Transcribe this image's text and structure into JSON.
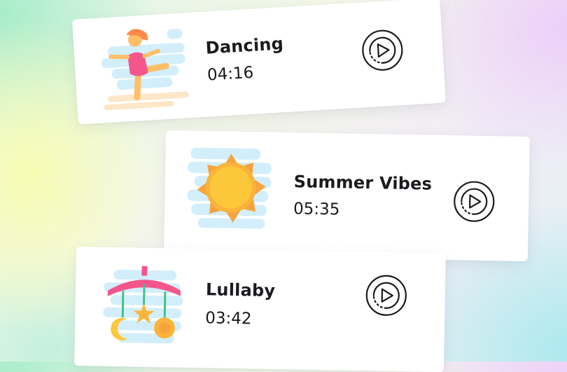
{
  "tracks": [
    {
      "title": "Dancing",
      "duration": "04:16",
      "thumbnail_icon": "dancing-girl-icon",
      "action_icon": "play-icon"
    },
    {
      "title": "Summer Vibes",
      "duration": "05:35",
      "thumbnail_icon": "sun-icon",
      "action_icon": "play-icon"
    },
    {
      "title": "Lullaby",
      "duration": "03:42",
      "thumbnail_icon": "baby-mobile-icon",
      "action_icon": "play-icon"
    }
  ],
  "colors": {
    "card_background": "#ffffff",
    "text": "#1b1b1f",
    "sun_outer": "#f5a43d",
    "sun_inner": "#fcc73a",
    "thumbnail_backdrop": "#d2eefb",
    "accent_pink": "#f4568c",
    "accent_orange": "#ff9a4a"
  }
}
